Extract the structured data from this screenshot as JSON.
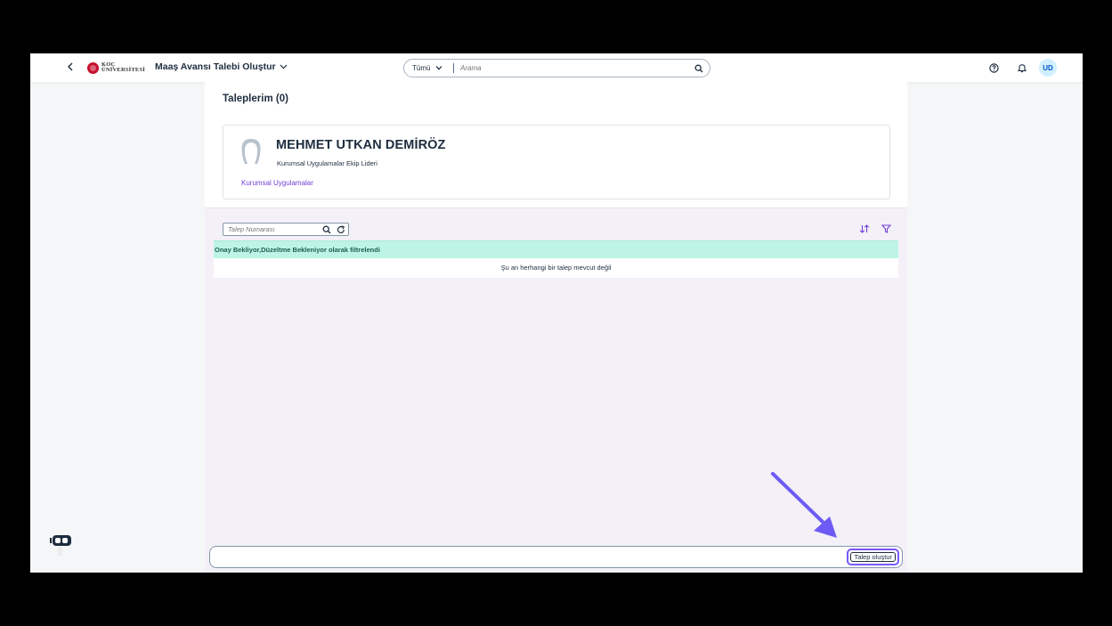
{
  "shell": {
    "back_icon": "chevron-left-icon",
    "logo_line1": "KOÇ",
    "logo_line2": "ÜNİVERSİTESİ",
    "app_title": "Maaş Avansı Talebi Oluştur",
    "search_scope": "Tümü",
    "search_placeholder": "Arama",
    "user_initials": "UD"
  },
  "header": {
    "title": "Taleplerim (0)"
  },
  "profile": {
    "name": "MEHMET UTKAN DEMİRÖZ",
    "role": "Kurumsal Uygulamalar Ekip Lideri",
    "department": "Kurumsal Uygulamalar"
  },
  "list": {
    "search_placeholder": "Talep Numarası",
    "filter_info": "Onay Bekliyor,Düzeltme Bekleniyor olarak filtrelendi",
    "empty_text": "Şu an herhangi bir talep mevcut değil"
  },
  "footer": {
    "create_label": "Talep oluştur"
  },
  "colors": {
    "accent": "#7858ff",
    "link": "#7540d6",
    "info_bar": "#bef4e6",
    "page_bg": "#f3f0f7"
  }
}
